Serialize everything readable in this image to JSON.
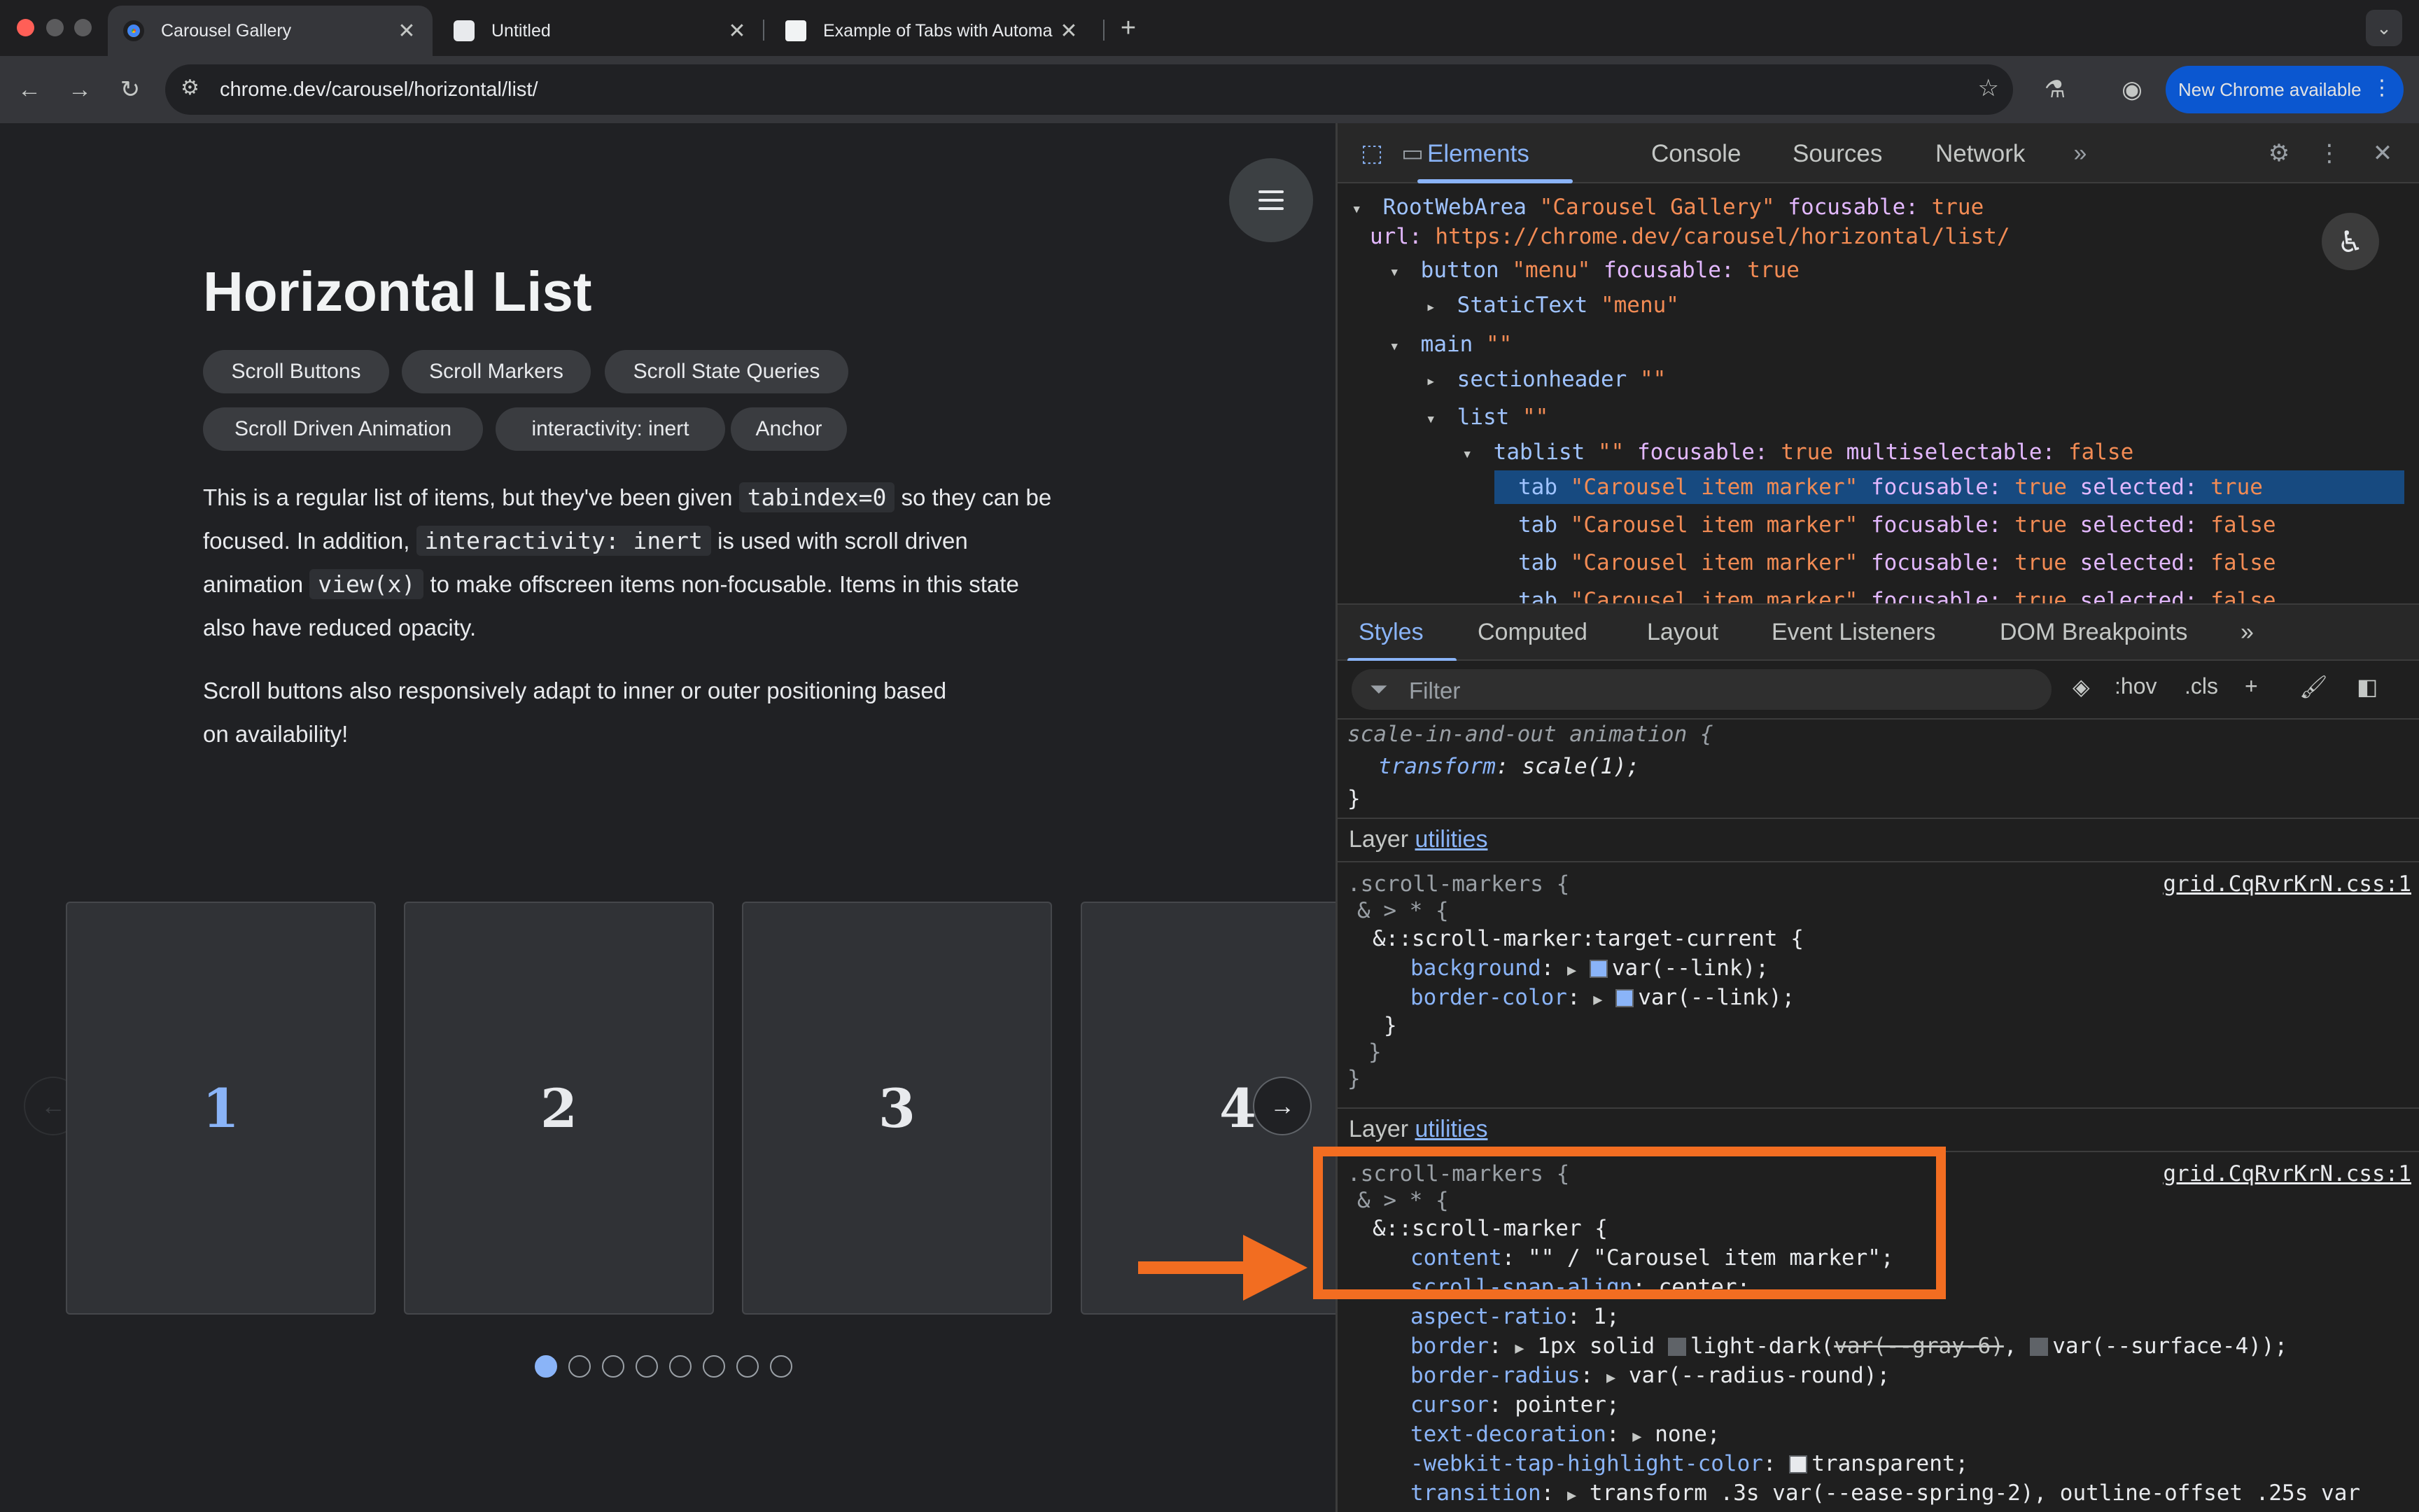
{
  "browser": {
    "tabs": [
      {
        "title": "Carousel Gallery",
        "favicon": "chrome-favicon",
        "active": true
      },
      {
        "title": "Untitled",
        "favicon": "codepen-favicon",
        "active": false
      },
      {
        "title": "Example of Tabs with Automa",
        "favicon": "w3c-favicon",
        "active": false
      }
    ],
    "url": "chrome.dev/carousel/horizontal/list/",
    "new_chrome_label": "New Chrome available",
    "accent": "#0b57d0"
  },
  "page": {
    "title": "Horizontal List",
    "chips": [
      "Scroll Buttons",
      "Scroll Markers",
      "Scroll State Queries",
      "Scroll Driven Animation",
      "interactivity: inert",
      "Anchor"
    ],
    "para1": {
      "t1": "This is a regular list of items, but they've been given",
      "c1": "tabindex=0",
      "t2": "so they can be",
      "t3": "focused. In addition,",
      "c2": "interactivity: inert",
      "t4": "is used with scroll driven",
      "t5": "animation",
      "c3": "view(x)",
      "t6": "to make offscreen items non-focusable. Items in this state",
      "t7": "also have reduced opacity."
    },
    "para2": {
      "line1": "Scroll buttons also responsively adapt to inner or outer positioning based",
      "line2": "on availability!"
    },
    "cards": [
      "1",
      "2",
      "3",
      "4"
    ],
    "scroll_markers": {
      "count": 8,
      "active_index": 0
    },
    "link_color": "#8ab4f8"
  },
  "devtools": {
    "tabs": [
      "Elements",
      "Console",
      "Sources",
      "Network"
    ],
    "active_tab": "Elements",
    "tree": {
      "root_role": "RootWebArea",
      "root_name": "\"Carousel Gallery\"",
      "focusable": "focusable:",
      "true": "true",
      "false": "false",
      "url_key": "url:",
      "url_val": "https://chrome.dev/carousel/horizontal/list/",
      "button_role": "button",
      "button_name": "\"menu\"",
      "statictext_role": "StaticText",
      "statictext_name": "\"menu\"",
      "main_role": "main",
      "empty_name": "\"\"",
      "sectionheader_role": "sectionheader",
      "list_role": "list",
      "tablist_role": "tablist",
      "multiselectable": "multiselectable:",
      "tab_role": "tab",
      "tab_name": "\"Carousel item marker\"",
      "selected": "selected:"
    },
    "subtabs": [
      "Styles",
      "Computed",
      "Layout",
      "Event Listeners",
      "DOM Breakpoints"
    ],
    "filter_placeholder": "Filter",
    "hov": ":hov",
    "cls": ".cls",
    "styles": {
      "anim_selector": "scale-in-and-out animation {",
      "anim_prop": "transform",
      "anim_val": "scale(1);",
      "close": "}",
      "layer_label": "Layer",
      "layer_link": "utilities",
      "sel1": ".scroll-markers {",
      "nest": "& > * {",
      "pseudo1": "&::scroll-marker:target-current {",
      "bg_prop": "background",
      "border_color_prop": "border-color",
      "var_link": "var(--link);",
      "src": "grid.CqRvrKrN.css:1",
      "pseudo2": "&::scroll-marker {",
      "content_prop": "content",
      "content_val": "\"\" / \"Carousel item marker\";",
      "snap_prop": "scroll-snap-align",
      "snap_val": "center;",
      "aspect_prop": "aspect-ratio",
      "aspect_val": "1;",
      "border_prop": "border",
      "border_val1": "1px solid",
      "border_fn": "light-dark(",
      "border_strike": "var(--gray-6)",
      "border_comma": ",",
      "border_val2": "var(--surface-4));",
      "radius_prop": "border-radius",
      "radius_val": "var(--radius-round);",
      "cursor_prop": "cursor",
      "cursor_val": "pointer;",
      "deco_prop": "text-decoration",
      "deco_val": "none;",
      "tap_prop": "-webkit-tap-highlight-color",
      "tap_val": "transparent;",
      "transition_prop": "transition",
      "transition_val": "transform .3s var(--ease-spring-2), outline-offset .25s var"
    }
  },
  "annotation": {
    "color": "#f26d21"
  }
}
